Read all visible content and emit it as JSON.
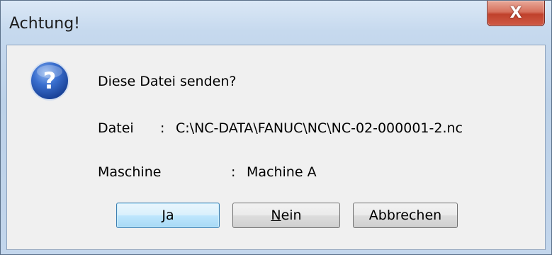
{
  "window": {
    "title": "Achtung!",
    "close_glyph": "X"
  },
  "message": {
    "icon": "question-icon",
    "question": "Diese Datei senden?",
    "file_label": "Datei",
    "file_sep": ":",
    "file_value": "C:\\NC-DATA\\FANUC\\NC\\NC-02-000001-2.nc",
    "machine_label": "Maschine",
    "machine_sep": ":",
    "machine_value": "Machine A"
  },
  "buttons": {
    "yes_label": "Ja",
    "no_mnemonic": "N",
    "no_rest": "ein",
    "cancel_label": "Abbrechen"
  },
  "colors": {
    "title_bar": "#c3d6ec",
    "close_button": "#c0412c",
    "client_bg": "#f0f0f0",
    "default_button_border": "#3c7fb1"
  }
}
